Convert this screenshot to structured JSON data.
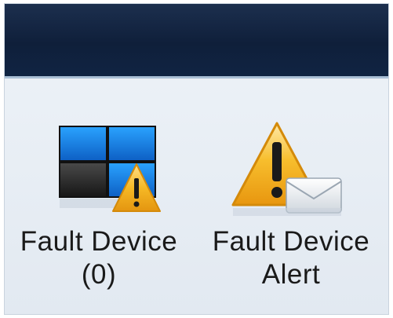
{
  "toolbar": {
    "items": [
      {
        "label_line1": "Fault Device",
        "label_line2": "(0)",
        "icon": "monitor-grid-warning-icon"
      },
      {
        "label_line1": "Fault Device",
        "label_line2": "Alert",
        "icon": "warning-envelope-icon"
      }
    ]
  },
  "colors": {
    "titlebar": "#13264a",
    "toolbar_bg": "#e6edf4",
    "warning_yellow": "#f2b21c",
    "screen_blue": "#1f86e6"
  }
}
